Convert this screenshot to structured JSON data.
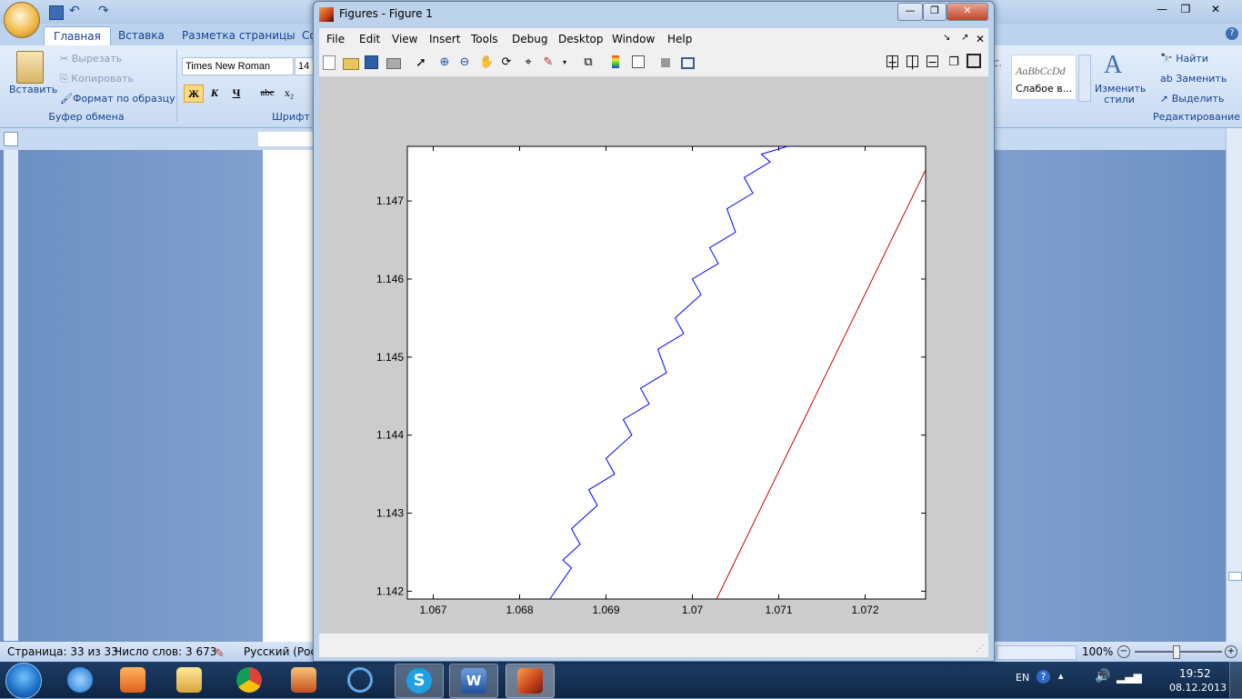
{
  "word": {
    "tabs": [
      "Главная",
      "Вставка",
      "Разметка страницы",
      "Сс"
    ],
    "clipboard": {
      "paste": "Вставить",
      "cut": "Вырезать",
      "copy": "Копировать",
      "format_painter": "Формат по образцу",
      "group": "Буфер обмена"
    },
    "font": {
      "name": "Times New Roman",
      "size": "14",
      "group": "Шрифт",
      "bold": "Ж",
      "italic": "К",
      "underline": "Ч",
      "strike": "abc",
      "subscript": "x₂"
    },
    "styles": {
      "sample1": "AaBbCcDd",
      "sample1_label": "Слабое в...",
      "sample0": "с.",
      "change_styles": "Изменить стили"
    },
    "editing": {
      "find": "Найти",
      "replace": "Заменить",
      "select": "Выделить",
      "group": "Редактирование"
    },
    "status": {
      "page": "Страница: 33 из 33",
      "words": "Число слов: 3 673",
      "language": "Русский (Росси",
      "zoom": "100%"
    }
  },
  "figure": {
    "window_title": "Figures - Figure 1",
    "menu": [
      "File",
      "Edit",
      "View",
      "Insert",
      "Tools",
      "Debug",
      "Desktop",
      "Window",
      "Help"
    ],
    "icons": [
      "new-figure-icon",
      "open-icon",
      "save-icon",
      "print-icon",
      "pointer-icon",
      "zoom-in-icon",
      "zoom-out-icon",
      "pan-icon",
      "rotate-icon",
      "data-cursor-icon",
      "brush-icon",
      "link-icon",
      "colorbar-icon",
      "legend-icon",
      "hide-plot-icon",
      "show-plot-icon"
    ]
  },
  "chart_data": {
    "type": "line",
    "xlim": [
      1.0667,
      1.0727
    ],
    "ylim": [
      1.1419,
      1.1477
    ],
    "xticks": [
      "1.067",
      "1.068",
      "1.069",
      "1.07",
      "1.071",
      "1.072"
    ],
    "yticks": [
      "1.142",
      "1.143",
      "1.144",
      "1.145",
      "1.146",
      "1.147"
    ],
    "xtick_values": [
      1.067,
      1.068,
      1.069,
      1.07,
      1.071,
      1.072
    ],
    "ytick_values": [
      1.142,
      1.143,
      1.144,
      1.145,
      1.146,
      1.147
    ],
    "grid": false,
    "series": [
      {
        "color": "#0000ff",
        "x": [
          1.06835,
          1.0686,
          1.0685,
          1.0687,
          1.0686,
          1.0689,
          1.0688,
          1.0691,
          1.069,
          1.0693,
          1.0692,
          1.0695,
          1.0694,
          1.0697,
          1.0696,
          1.0699,
          1.0698,
          1.0701,
          1.07,
          1.0703,
          1.0702,
          1.0705,
          1.0704,
          1.0707,
          1.0706,
          1.0709,
          1.0708,
          1.0711,
          1.071,
          1.0712
        ],
        "y": [
          1.1419,
          1.1423,
          1.1424,
          1.1426,
          1.1428,
          1.1431,
          1.1433,
          1.1435,
          1.1437,
          1.144,
          1.1442,
          1.1444,
          1.1446,
          1.1448,
          1.1451,
          1.1453,
          1.1455,
          1.1458,
          1.146,
          1.1462,
          1.1464,
          1.1466,
          1.1469,
          1.1471,
          1.1473,
          1.1475,
          1.1476,
          1.1477,
          1.1477,
          1.1477
        ]
      },
      {
        "color": "#cc0000",
        "x": [
          1.07028,
          1.0727
        ],
        "y": [
          1.1419,
          1.1474
        ]
      }
    ]
  },
  "taskbar": {
    "apps": [
      "ie-icon",
      "media-icon",
      "explorer-icon",
      "chrome-icon",
      "installer-icon",
      "bluetooth-icon",
      "skype-icon",
      "word-icon",
      "matlab-icon"
    ],
    "lang": "EN",
    "time": "19:52",
    "date": "08.12.2013"
  }
}
